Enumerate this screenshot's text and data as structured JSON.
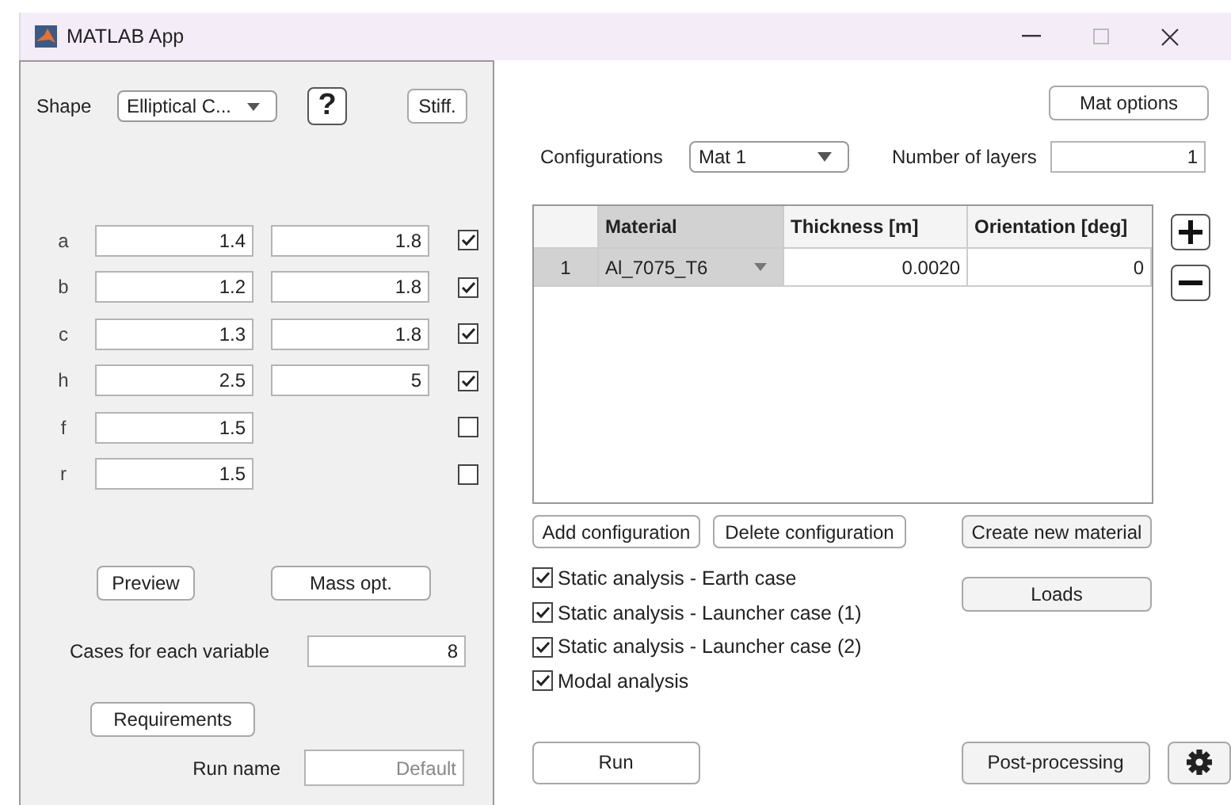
{
  "window": {
    "title": "MATLAB App"
  },
  "left": {
    "shape": {
      "label": "Shape",
      "value": "Elliptical C..."
    },
    "help_button": "?",
    "stiff_button": "Stiff.",
    "parameters": [
      {
        "name": "a",
        "min": "1.4",
        "max": "1.8",
        "checked": true
      },
      {
        "name": "b",
        "min": "1.2",
        "max": "1.8",
        "checked": true
      },
      {
        "name": "c",
        "min": "1.3",
        "max": "1.8",
        "checked": true
      },
      {
        "name": "h",
        "min": "2.5",
        "max": "5",
        "checked": true
      },
      {
        "name": "f",
        "min": "1.5",
        "checked": false
      },
      {
        "name": "r",
        "min": "1.5",
        "checked": false
      }
    ],
    "preview_button": "Preview",
    "mass_opt_button": "Mass opt.",
    "cases": {
      "label": "Cases for each variable",
      "value": "8"
    },
    "requirements_button": "Requirements",
    "run_name": {
      "label": "Run name",
      "placeholder": "Default"
    }
  },
  "right": {
    "mat_options_button": "Mat options",
    "configurations": {
      "label": "Configurations",
      "value": "Mat 1"
    },
    "layers": {
      "label": "Number of layers",
      "value": "1"
    },
    "table": {
      "columns": [
        {
          "label": "Material",
          "selected": true
        },
        {
          "label": "Thickness [m]",
          "selected": false
        },
        {
          "label": "Orientation [deg]",
          "selected": false
        }
      ],
      "rows": [
        {
          "index": "1",
          "material": "Al_7075_T6",
          "thickness": "0.0020",
          "orientation": "0"
        }
      ]
    },
    "add_configuration_button": "Add configuration",
    "delete_configuration_button": "Delete configuration",
    "create_material_button": "Create new material",
    "analyses": [
      {
        "label": "Static analysis - Earth case",
        "checked": true
      },
      {
        "label": "Static analysis - Launcher case (1)",
        "checked": true
      },
      {
        "label": "Static analysis - Launcher case (2)",
        "checked": true
      },
      {
        "label": "Modal analysis",
        "checked": true
      }
    ],
    "loads_button": "Loads",
    "run_button": "Run",
    "post_processing_button": "Post-processing"
  }
}
